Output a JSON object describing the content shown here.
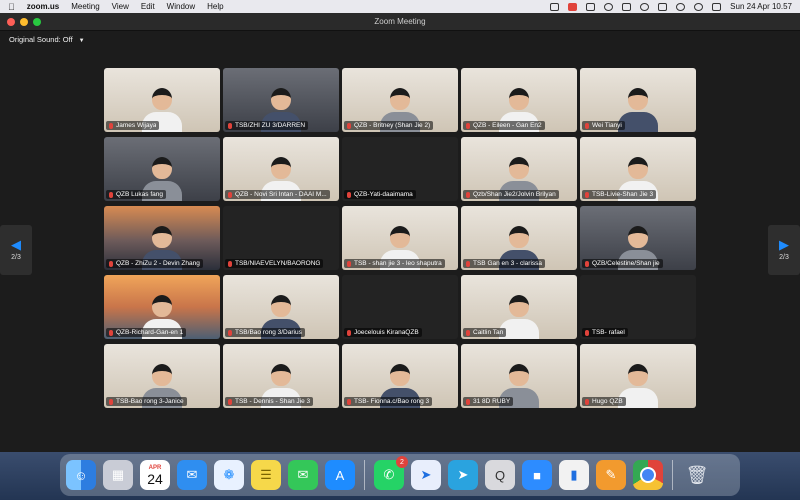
{
  "menubar": {
    "app_name": "zoom.us",
    "menus": [
      "Meeting",
      "View",
      "Edit",
      "Window",
      "Help"
    ],
    "datetime": "Sun 24 Apr  10.57"
  },
  "window": {
    "title": "Zoom Meeting",
    "original_sound": "Original Sound: Off",
    "page_left": "2/3",
    "page_right": "2/3",
    "accent_color": "#1e8cff"
  },
  "participants": [
    {
      "name": "James Wijaya",
      "video": "room"
    },
    {
      "name": "TSB/ZHI ZU 3/DARREN",
      "video": "dark"
    },
    {
      "name": "QZB - Britney (Shan Jie 2)",
      "video": "room"
    },
    {
      "name": "QZB - Eileen - Gan En2",
      "video": "room"
    },
    {
      "name": "Wei Tianyi",
      "video": "room"
    },
    {
      "name": "QZB Lukas fang",
      "video": "dark"
    },
    {
      "name": "QZB - Novi Sri Intan - DAAI M...",
      "video": "room"
    },
    {
      "name": "QZB-Yati-daaimama",
      "video": "none"
    },
    {
      "name": "Qzb/Shan Jie2/Jolvin Brilyan",
      "video": "room"
    },
    {
      "name": "TSB-Livie-Shan Jie 3",
      "video": "room"
    },
    {
      "name": "QZB - ZhiZu 2 - Devin Zhang",
      "video": "city"
    },
    {
      "name": "TSB/NIAEVELYN/BAORONG",
      "video": "none"
    },
    {
      "name": "TSB - shan jie 3 - leo shaputra",
      "video": "room"
    },
    {
      "name": "TSB Gan en 3 - clarissa",
      "video": "room"
    },
    {
      "name": "QZB/Celestine/Shan jie",
      "video": "dark"
    },
    {
      "name": "QZB-Richard-Gan-en 1",
      "video": "sunset"
    },
    {
      "name": "TSB/Bao rong 3/Darius",
      "video": "room"
    },
    {
      "name": "Joecelouis KiranaQZB",
      "video": "none"
    },
    {
      "name": "Caitlin Tan",
      "video": "room"
    },
    {
      "name": "TSB- rafael",
      "video": "none"
    },
    {
      "name": "TSB-Bao rong 3-Janice",
      "video": "room"
    },
    {
      "name": "TSB - Dennis - Shan Jie 3",
      "video": "room"
    },
    {
      "name": "TSB- Fionna.c/Bao rong 3",
      "video": "room"
    },
    {
      "name": "31 8D RUBY",
      "video": "room"
    },
    {
      "name": "Hugo QZB",
      "video": "room"
    }
  ],
  "dock": {
    "apps": [
      "finder-icon",
      "launchpad-icon",
      "calendar-icon",
      "mail-icon",
      "safari-icon",
      "notes-icon",
      "messages-icon",
      "appstore-icon",
      "whatsapp-icon",
      "testflight-icon",
      "telegram-icon",
      "quicktime-icon",
      "zoom-icon",
      "keynote-icon",
      "pages-icon",
      "chrome-icon",
      "trash-icon"
    ],
    "calendar_month": "APR",
    "calendar_day": "24",
    "whatsapp_badge": "2"
  }
}
